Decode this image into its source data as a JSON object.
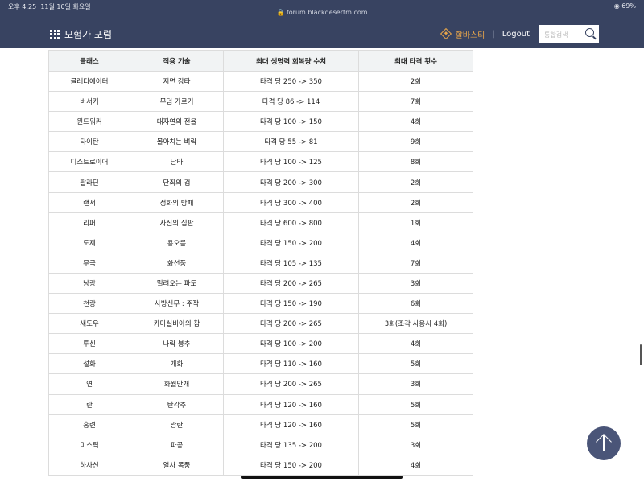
{
  "status": {
    "time": "오후 4:25",
    "date": "11월 10일 화요일",
    "url": "forum.blackdesertm.com",
    "battery": "69%"
  },
  "nav": {
    "title": "모험가 포럼",
    "halbasti": "할바스티",
    "separator": "|",
    "logout": "Logout",
    "search_placeholder": "통합검색"
  },
  "table": {
    "headers": [
      "클래스",
      "적용 기술",
      "최대 생명력 회복량 수치",
      "최대 타격 횟수"
    ],
    "rows": [
      [
        "글레디에이터",
        "지면 강타",
        "타격 당 250 -> 350",
        "2회"
      ],
      [
        "버서커",
        "무덤 가르기",
        "타격 당 86 -> 114",
        "7회"
      ],
      [
        "윈드워커",
        "대자연의 전율",
        "타격 당 100 -> 150",
        "4회"
      ],
      [
        "타이탄",
        "몰아치는 벼락",
        "타격 당 55 -> 81",
        "9회"
      ],
      [
        "디스트로이어",
        "난타",
        "타격 당 100 -> 125",
        "8회"
      ],
      [
        "팔라딘",
        "단죄의 검",
        "타격 당 200 -> 300",
        "2회"
      ],
      [
        "랜서",
        "정화의 방패",
        "타격 당 300 -> 400",
        "2회"
      ],
      [
        "리퍼",
        "사신의 심판",
        "타격 당 600 -> 800",
        "1회"
      ],
      [
        "도제",
        "용오름",
        "타격 당 150 -> 200",
        "4회"
      ],
      [
        "무극",
        "화선풍",
        "타격 당 105 -> 135",
        "7회"
      ],
      [
        "낭랑",
        "밀려오는 파도",
        "타격 당 200 -> 265",
        "3회"
      ],
      [
        "천랑",
        "사방신무 : 주작",
        "타격 당 150 -> 190",
        "6회"
      ],
      [
        "섀도우",
        "카마실비아의 참",
        "타격 당 200 -> 265",
        "3회(조각 사용시 4회)"
      ],
      [
        "투신",
        "나락 붕추",
        "타격 당 100 -> 200",
        "4회"
      ],
      [
        "설화",
        "개화",
        "타격 당 110 -> 160",
        "5회"
      ],
      [
        "연",
        "화월만개",
        "타격 당 200 -> 265",
        "3회"
      ],
      [
        "란",
        "탄각추",
        "타격 당 120 -> 160",
        "5회"
      ],
      [
        "홍련",
        "광란",
        "타격 당 120 -> 160",
        "5회"
      ],
      [
        "미스틱",
        "파공",
        "타격 당 135 -> 200",
        "3회"
      ],
      [
        "하사신",
        "열사 폭풍",
        "타격 당 150 -> 200",
        "4회"
      ]
    ]
  },
  "icons": {
    "menu": "grid-menu-icon",
    "halbasti": "diamond-icon",
    "search": "search-icon",
    "scroll_top": "arrow-up-icon"
  },
  "colors": {
    "navbar": "#384361",
    "accent": "#e8a64a",
    "header_bg": "#f1f3f4",
    "scroll_button": "#4a5578"
  }
}
